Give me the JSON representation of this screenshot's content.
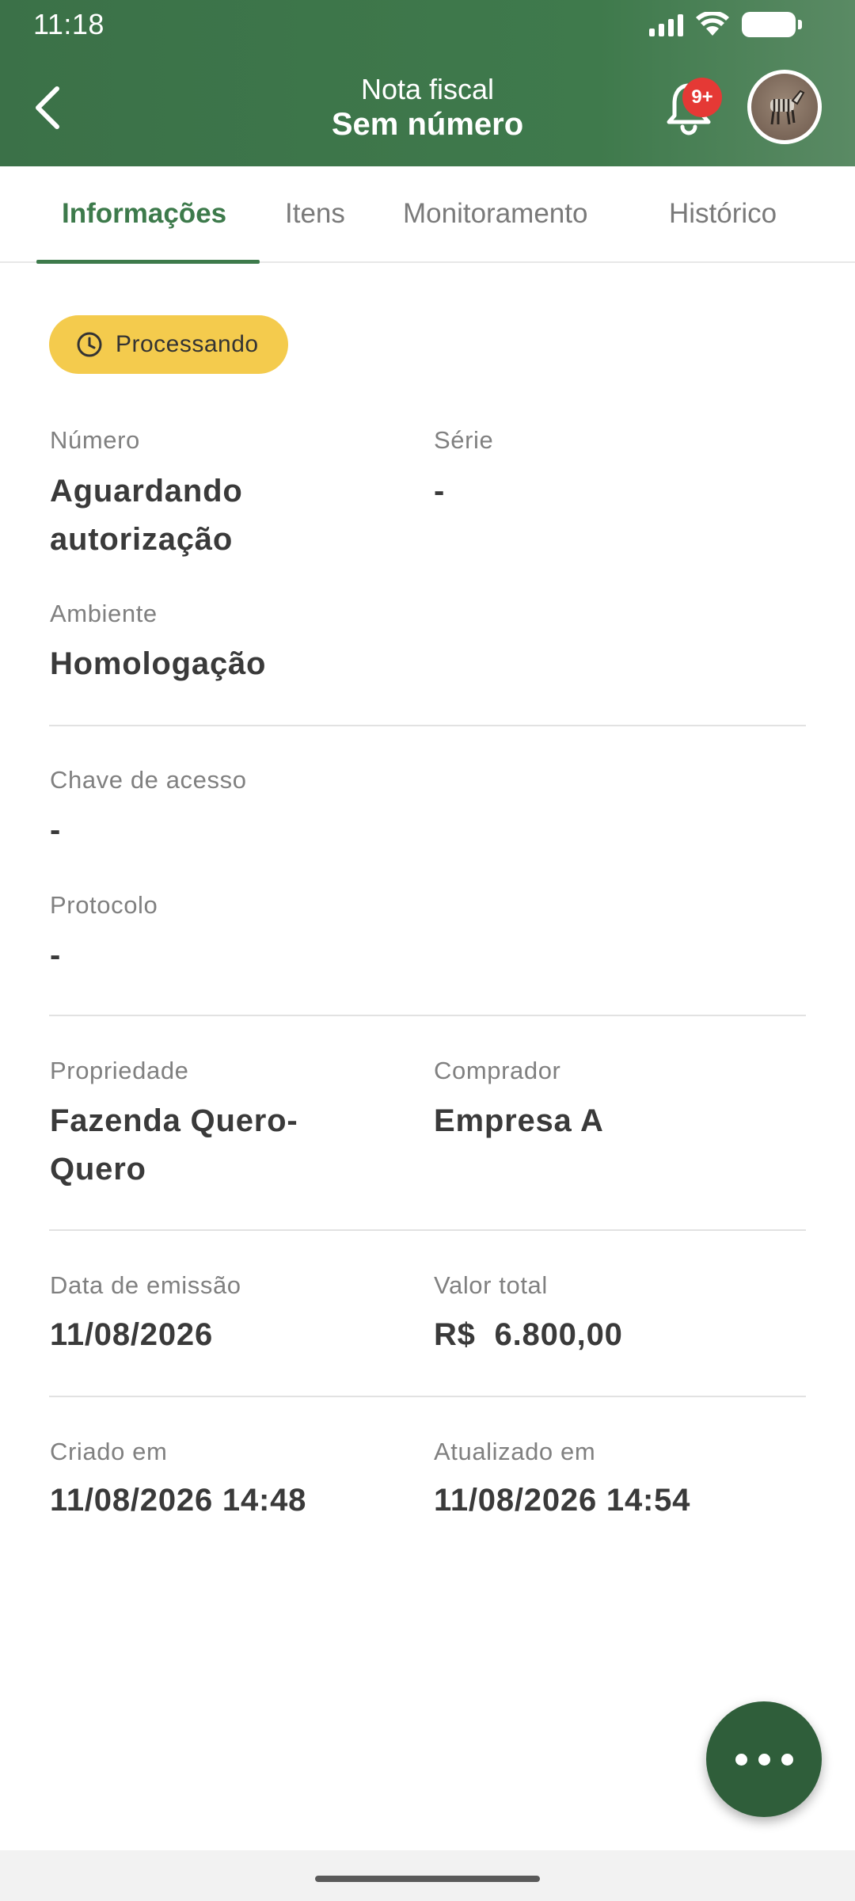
{
  "status_bar": {
    "time": "11:18"
  },
  "header": {
    "subtitle": "Nota fiscal",
    "title": "Sem número",
    "notification_badge": "9+"
  },
  "tabs": [
    {
      "label": "Informações",
      "active": true
    },
    {
      "label": "Itens",
      "active": false
    },
    {
      "label": "Monitoramento",
      "active": false
    },
    {
      "label": "Histórico",
      "active": false
    }
  ],
  "status_chip": {
    "label": "Processando",
    "color": "#f4cb4d",
    "icon": "clock-icon"
  },
  "fields": {
    "numero": {
      "label": "Número",
      "value": "Aguardando autorização"
    },
    "serie": {
      "label": "Série",
      "value": "-"
    },
    "ambiente": {
      "label": "Ambiente",
      "value": "Homologação"
    },
    "chave": {
      "label": "Chave de acesso",
      "value": "-"
    },
    "protocolo": {
      "label": "Protocolo",
      "value": "-"
    },
    "propriedade": {
      "label": "Propriedade",
      "value": "Fazenda Quero-Quero"
    },
    "comprador": {
      "label": "Comprador",
      "value": "Empresa A"
    },
    "data_emissao": {
      "label": "Data de emissão",
      "value": "11/08/2026"
    },
    "valor_total": {
      "label": "Valor total",
      "value": "R$  6.800,00"
    },
    "criado_em": {
      "label": "Criado em",
      "value": "11/08/2026 14:48"
    },
    "atualizado_em": {
      "label": "Atualizado em",
      "value": "11/08/2026 14:54"
    }
  },
  "colors": {
    "header": "#3d7a4b",
    "accent": "#3d7a4b",
    "fab": "#2f5e3a",
    "badge": "#e53935"
  }
}
